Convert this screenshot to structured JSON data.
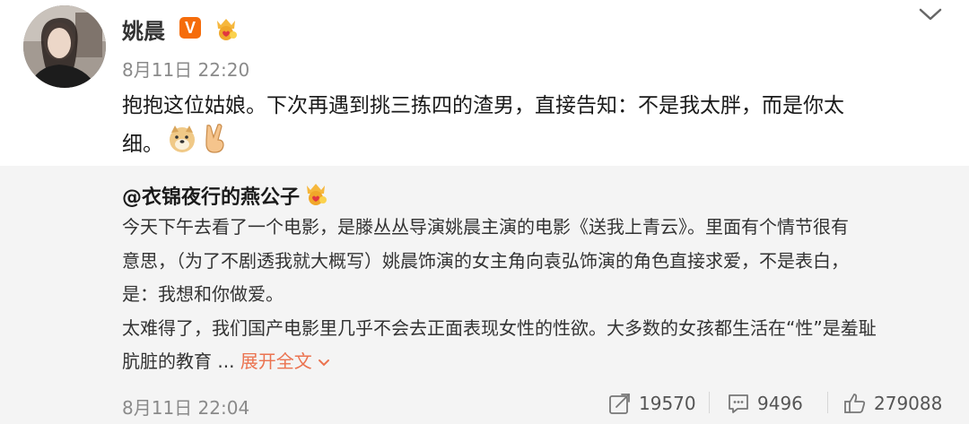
{
  "post": {
    "author": "姚晨",
    "verified_badge": "V",
    "time": "8月11日 22:20",
    "text": "抱抱这位姑娘。下次再遇到挑三拣四的渣男，直接告知：不是我太胖，而是你太细。",
    "text_line1": "抱抱这位姑娘。下次再遇到挑三拣四的渣男，直接告知：不是我太胖，而是你太",
    "text_line2": "细。",
    "emojis": [
      "doge-icon",
      "peace-hand-icon"
    ],
    "menu_icon": "chevron-down-icon"
  },
  "repost": {
    "author": "@衣锦夜行的燕公子",
    "lines": [
      "今天下午去看了一个电影，是滕丛丛导演姚晨主演的电影《送我上青云》。里面有个情节很有",
      "意思，（为了不剧透我就大概写）姚晨饰演的女主角向袁弘饰演的角色直接求爱，不是表白，",
      "是：我想和你做爱。",
      "太难得了，我们国产电影里几乎不会去正面表现女性的性欲。大多数的女孩都生活在“性”是羞耻",
      "肮脏的教育 ..."
    ],
    "expand_label": "展开全文",
    "time": "8月11日 22:04",
    "stats": {
      "repost_count": "19570",
      "comment_count": "9496",
      "like_count": "279088"
    }
  },
  "colors": {
    "badge_orange": "#f56c0b",
    "link_orange": "#eb7350",
    "repost_bg": "#f4f4f4",
    "meta_gray": "#8a8a8a"
  }
}
